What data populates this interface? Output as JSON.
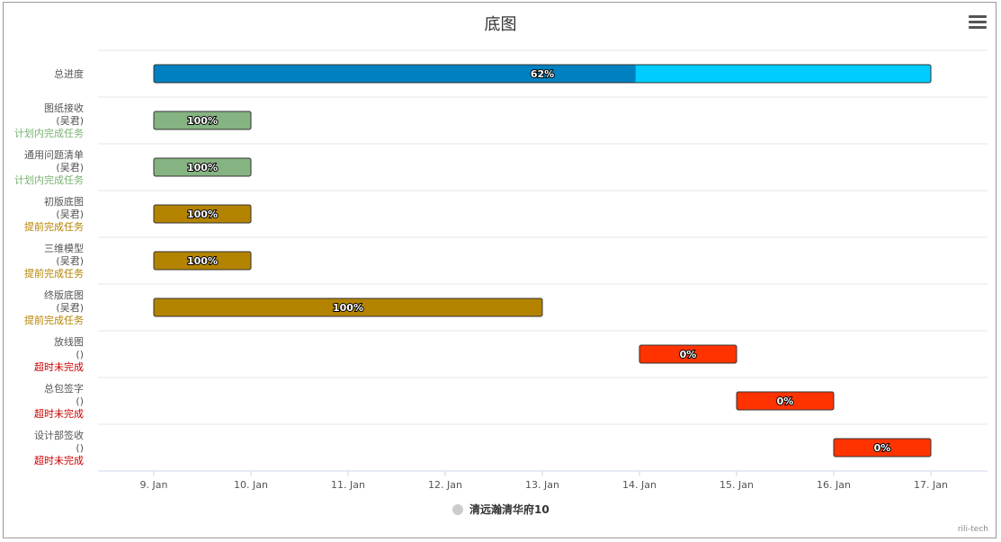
{
  "chart_data": {
    "type": "gantt",
    "title": "底图",
    "x_axis": {
      "type": "datetime",
      "range": [
        "2024-01-09",
        "2024-01-17"
      ],
      "tick_labels": [
        "9. Jan",
        "10. Jan",
        "11. Jan",
        "12. Jan",
        "13. Jan",
        "14. Jan",
        "15. Jan",
        "16. Jan",
        "17. Jan"
      ]
    },
    "legend": {
      "series_name": "清远瀚清华府10",
      "placement": "bottom-center"
    },
    "tasks": [
      {
        "name": "总进度",
        "owner": "",
        "status": "",
        "start": "2024-01-09",
        "end": "2024-01-17",
        "completed": 0.62,
        "label": "62%",
        "color": "#00CCFF",
        "completed_color": "#0080BF",
        "status_color": ""
      },
      {
        "name": "图纸接收",
        "owner": "(吴君)",
        "status": "计划内完成任务",
        "start": "2024-01-09",
        "end": "2024-01-10",
        "completed": 1.0,
        "label": "100%",
        "color": "#85B381",
        "completed_color": "#85B381",
        "status_color": "#77B36F"
      },
      {
        "name": "通用问题清单",
        "owner": "(吴君)",
        "status": "计划内完成任务",
        "start": "2024-01-09",
        "end": "2024-01-10",
        "completed": 1.0,
        "label": "100%",
        "color": "#85B381",
        "completed_color": "#85B381",
        "status_color": "#77B36F"
      },
      {
        "name": "初版底图",
        "owner": "(吴君)",
        "status": "提前完成任务",
        "start": "2024-01-09",
        "end": "2024-01-10",
        "completed": 1.0,
        "label": "100%",
        "color": "#B38300",
        "completed_color": "#B38300",
        "status_color": "#B38300"
      },
      {
        "name": "三维模型",
        "owner": "(吴君)",
        "status": "提前完成任务",
        "start": "2024-01-09",
        "end": "2024-01-10",
        "completed": 1.0,
        "label": "100%",
        "color": "#B38300",
        "completed_color": "#B38300",
        "status_color": "#B38300"
      },
      {
        "name": "终版底图",
        "owner": "(吴君)",
        "status": "提前完成任务",
        "start": "2024-01-09",
        "end": "2024-01-13",
        "completed": 1.0,
        "label": "100%",
        "color": "#B38300",
        "completed_color": "#B38300",
        "status_color": "#B38300"
      },
      {
        "name": "放线图",
        "owner": "()",
        "status": "超时未完成",
        "start": "2024-01-14",
        "end": "2024-01-15",
        "completed": 0.0,
        "label": "0%",
        "color": "#FF3300",
        "completed_color": "#FF3300",
        "status_color": "#CC0000"
      },
      {
        "name": "总包签字",
        "owner": "()",
        "status": "超时未完成",
        "start": "2024-01-15",
        "end": "2024-01-16",
        "completed": 0.0,
        "label": "0%",
        "color": "#FF3300",
        "completed_color": "#FF3300",
        "status_color": "#CC0000"
      },
      {
        "name": "设计部签收",
        "owner": "()",
        "status": "超时未完成",
        "start": "2024-01-16",
        "end": "2024-01-17",
        "completed": 0.0,
        "label": "0%",
        "color": "#FF3300",
        "completed_color": "#FF3300",
        "status_color": "#CC0000"
      }
    ]
  },
  "menu": {
    "icon": "hamburger-menu-icon"
  },
  "credit": "rili-tech"
}
